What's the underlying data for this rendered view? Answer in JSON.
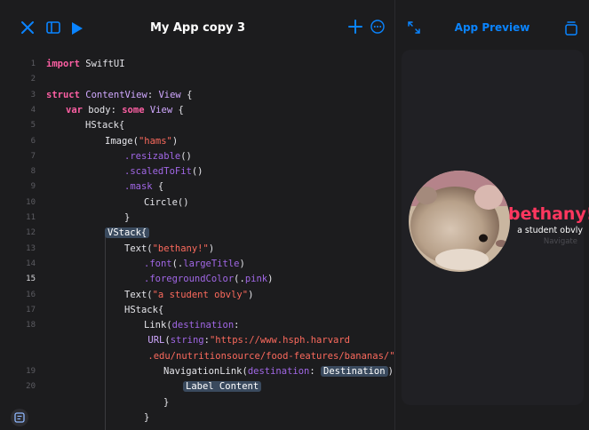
{
  "editor": {
    "title": "My App copy 3",
    "lines": [
      {
        "num": "1",
        "indent": 0,
        "parts": [
          [
            "kw",
            "import"
          ],
          [
            "plain",
            " SwiftUI"
          ]
        ]
      },
      {
        "num": "2",
        "indent": 0,
        "parts": []
      },
      {
        "num": "3",
        "indent": 0,
        "parts": [
          [
            "kw",
            "struct"
          ],
          [
            "plain",
            " "
          ],
          [
            "ty",
            "ContentView"
          ],
          [
            "plain",
            ": "
          ],
          [
            "ty",
            "View"
          ],
          [
            "plain",
            " {"
          ]
        ]
      },
      {
        "num": "4",
        "indent": 1,
        "parts": [
          [
            "kw",
            "var"
          ],
          [
            "plain",
            " body: "
          ],
          [
            "kw",
            "some"
          ],
          [
            "plain",
            " "
          ],
          [
            "ty",
            "View"
          ],
          [
            "plain",
            " {"
          ]
        ]
      },
      {
        "num": "5",
        "indent": 2,
        "parts": [
          [
            "plain",
            "HStack{"
          ]
        ]
      },
      {
        "num": "6",
        "indent": 3,
        "parts": [
          [
            "plain",
            "Image("
          ],
          [
            "str",
            "\"hams\""
          ],
          [
            "plain",
            ")"
          ]
        ]
      },
      {
        "num": "7",
        "indent": 4,
        "parts": [
          [
            "fn",
            ".resizable"
          ],
          [
            "plain",
            "()"
          ]
        ]
      },
      {
        "num": "8",
        "indent": 4,
        "parts": [
          [
            "fn",
            ".scaledToFit"
          ],
          [
            "plain",
            "()"
          ]
        ]
      },
      {
        "num": "9",
        "indent": 4,
        "parts": [
          [
            "fn",
            ".mask"
          ],
          [
            "plain",
            " {"
          ]
        ]
      },
      {
        "num": "10",
        "indent": 5,
        "parts": [
          [
            "plain",
            "Circle()"
          ]
        ]
      },
      {
        "num": "11",
        "indent": 4,
        "parts": [
          [
            "plain",
            "}"
          ]
        ]
      },
      {
        "num": "12",
        "indent": 3,
        "parts": [
          [
            "hl",
            "VStack{"
          ]
        ]
      },
      {
        "num": "13",
        "indent": 4,
        "parts": [
          [
            "plain",
            "Text("
          ],
          [
            "str",
            "\"bethany!\""
          ],
          [
            "plain",
            ")"
          ]
        ]
      },
      {
        "num": "14",
        "indent": 5,
        "parts": [
          [
            "fn",
            ".font"
          ],
          [
            "plain",
            "(."
          ],
          [
            "fn",
            "largeTitle"
          ],
          [
            "plain",
            ")"
          ]
        ]
      },
      {
        "num": "15",
        "indent": 5,
        "parts": [
          [
            "fn",
            ".foregroundColor"
          ],
          [
            "plain",
            "(."
          ],
          [
            "fn",
            "pink"
          ],
          [
            "plain",
            ")"
          ]
        ],
        "active": true
      },
      {
        "num": "16",
        "indent": 4,
        "parts": [
          [
            "plain",
            "Text("
          ],
          [
            "str",
            "\"a student obvly\""
          ],
          [
            "plain",
            ")"
          ]
        ]
      },
      {
        "num": "17",
        "indent": 4,
        "parts": [
          [
            "plain",
            "HStack{"
          ]
        ]
      },
      {
        "num": "18",
        "indent": 5,
        "parts": [
          [
            "plain",
            "Link("
          ],
          [
            "fn",
            "destination"
          ],
          [
            "plain",
            ":"
          ]
        ]
      },
      {
        "num": "",
        "indent": 5.2,
        "parts": [
          [
            "ty",
            "URL"
          ],
          [
            "plain",
            "("
          ],
          [
            "fn",
            "string"
          ],
          [
            "plain",
            ":"
          ],
          [
            "str",
            "\"https://www.hsph.harvard"
          ]
        ]
      },
      {
        "num": "",
        "indent": 5.2,
        "parts": [
          [
            "str",
            ".edu/nutritionsource/food-features/bananas/\""
          ],
          [
            "plain",
            ")!) {"
          ]
        ]
      },
      {
        "num": "19",
        "indent": 6,
        "parts": [
          [
            "plain",
            "NavigationLink("
          ],
          [
            "fn",
            "destination"
          ],
          [
            "plain",
            ": "
          ],
          [
            "ph",
            "Destination"
          ],
          [
            "plain",
            ") {"
          ]
        ]
      },
      {
        "num": "20",
        "indent": 7,
        "parts": [
          [
            "ph",
            "Label Content"
          ]
        ]
      },
      {
        "num": "",
        "indent": 6,
        "parts": [
          [
            "plain",
            "}"
          ]
        ]
      },
      {
        "num": "",
        "indent": 5,
        "parts": [
          [
            "plain",
            "}"
          ]
        ]
      }
    ]
  },
  "preview": {
    "title": "App Preview",
    "name": "bethany!",
    "subtitle": "a student obvly",
    "link_label": "Navigate"
  },
  "colors": {
    "accent": "#0a84ff",
    "pink": "#ff375f",
    "keyword": "#fc5fa3",
    "string": "#fc6a5d"
  }
}
